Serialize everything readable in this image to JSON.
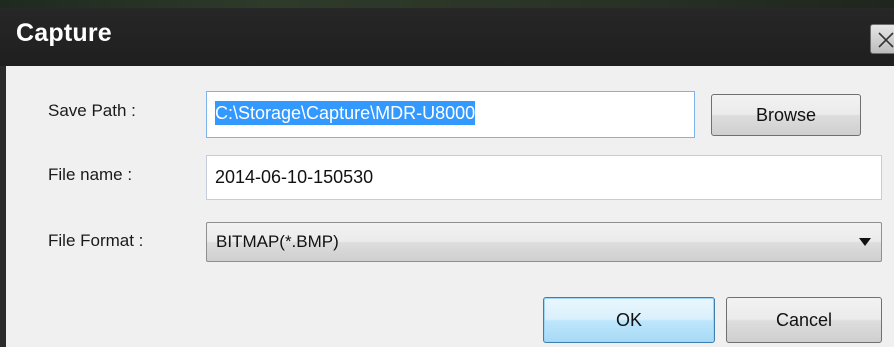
{
  "dialog": {
    "title": "Capture",
    "close_icon": "close-icon"
  },
  "save_path": {
    "label": "Save Path :",
    "value": "C:\\Storage\\Capture\\MDR-U8000",
    "browse_label": "Browse"
  },
  "file_name": {
    "label": "File name :",
    "value": "2014-06-10-150530"
  },
  "file_format": {
    "label": "File Format :",
    "selected": "BITMAP(*.BMP)",
    "arrow_icon": "dropdown-arrow-icon"
  },
  "actions": {
    "ok_label": "OK",
    "cancel_label": "Cancel"
  },
  "colors": {
    "titlebar": "#1f1f1f",
    "dialog_body": "#f0f0f0",
    "selection": "#3399ff",
    "default_button_border": "#3c7fb1"
  }
}
